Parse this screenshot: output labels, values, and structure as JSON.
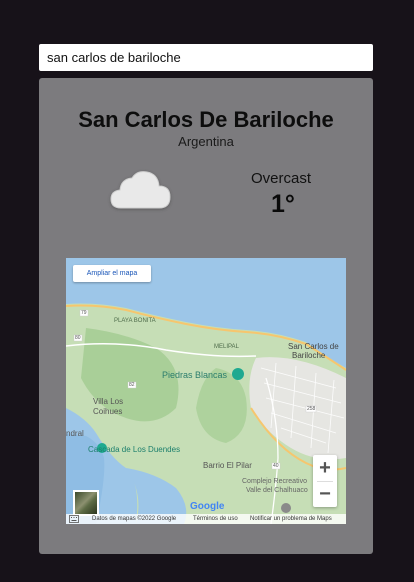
{
  "search": {
    "value": "san carlos de bariloche"
  },
  "location": {
    "city": "San Carlos De Bariloche",
    "country": "Argentina"
  },
  "weather": {
    "condition": "Overcast",
    "temperature": "1°",
    "icon": "cloud-icon"
  },
  "map": {
    "enlarge_label": "Ampliar el mapa",
    "labels": {
      "playa_bonita": "PLAYA BONITA",
      "melipal": "MELIPAL",
      "san_carlos_1": "San Carlos de",
      "san_carlos_2": "Bariloche",
      "piedras_blancas": "Piedras Blancas",
      "villa_los_1": "Villa Los",
      "villa_los_2": "Coihues",
      "cascada": "Cascada de Los Duendes",
      "barrio": "Barrio El Pilar",
      "complejo_1": "Complejo Recreativo",
      "complejo_2": "Valle del Chalhuaco",
      "ndral": "ndral",
      "road_79": "79",
      "road_80": "80",
      "road_82": "82",
      "road_40": "40",
      "road_258": "258"
    },
    "zoom_in": "+",
    "zoom_out": "−",
    "google": "Google",
    "attribution": {
      "data": "Datos de mapas ©2022 Google",
      "terms": "Términos de uso",
      "report": "Notificar un problema de Maps"
    },
    "colors": {
      "water": "#9dc6e8",
      "land": "#c8dfb9",
      "urban": "#ececec",
      "road": "#f6c66e"
    }
  }
}
